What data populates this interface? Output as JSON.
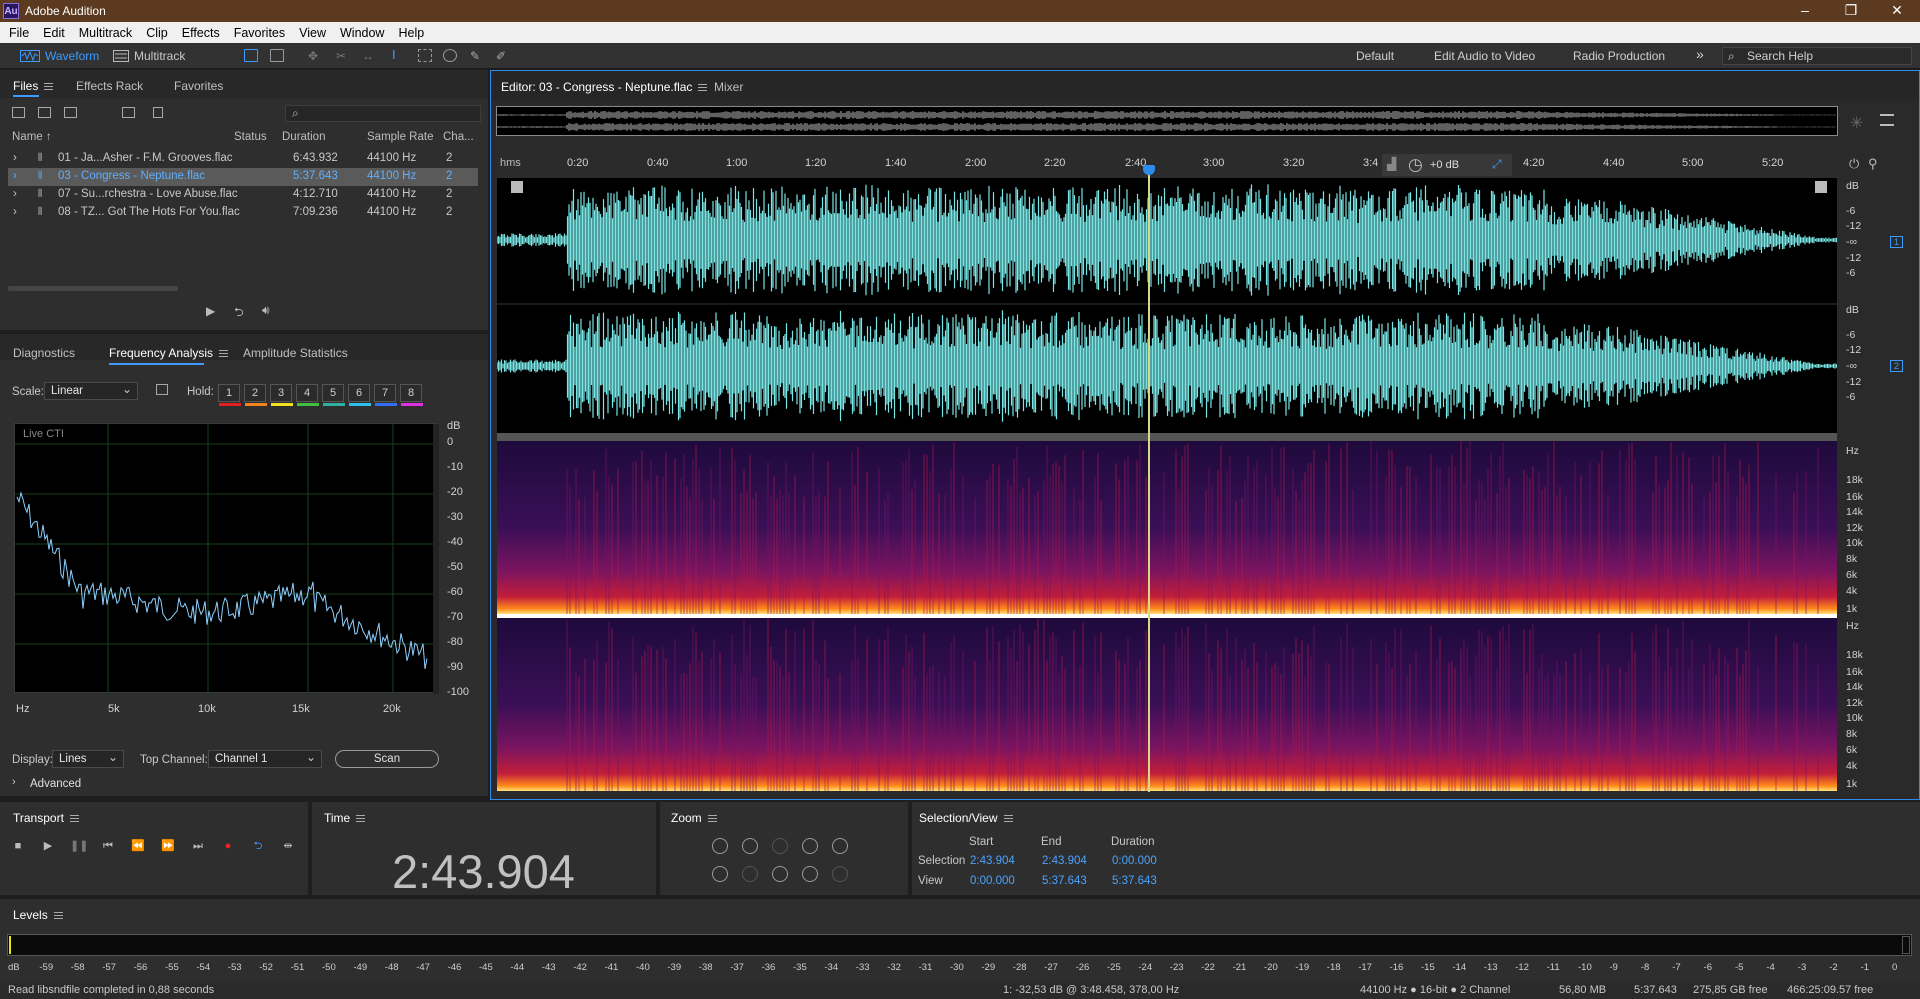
{
  "app": {
    "title": "Adobe Audition",
    "logo": "Au"
  },
  "menu": [
    "File",
    "Edit",
    "Multitrack",
    "Clip",
    "Effects",
    "Favorites",
    "View",
    "Window",
    "Help"
  ],
  "toolbar": {
    "waveform": "Waveform",
    "multitrack": "Multitrack",
    "workspaces": [
      "Default",
      "Edit Audio to Video",
      "Radio Production"
    ],
    "more": "»",
    "search_placeholder": "Search Help"
  },
  "files_panel": {
    "tabs": [
      "Files",
      "Effects Rack",
      "Favorites"
    ],
    "columns": [
      "Name ↑",
      "Status",
      "Duration",
      "Sample Rate",
      "Cha..."
    ],
    "rows": [
      {
        "name": "01 - Ja...Asher - F.M. Grooves.flac",
        "duration": "6:43.932",
        "rate": "44100 Hz",
        "ch": "2"
      },
      {
        "name": "03 - Congress - Neptune.flac",
        "duration": "5:37.643",
        "rate": "44100 Hz",
        "ch": "2"
      },
      {
        "name": "07 - Su...rchestra - Love Abuse.flac",
        "duration": "4:12.710",
        "rate": "44100 Hz",
        "ch": "2"
      },
      {
        "name": "08 - TZ... Got The Hots For You.flac",
        "duration": "7:09.236",
        "rate": "44100 Hz",
        "ch": "2"
      }
    ]
  },
  "analysis_panel": {
    "tabs": [
      "Diagnostics",
      "Frequency Analysis",
      "Amplitude Statistics"
    ],
    "scale_label": "Scale:",
    "scale_value": "Linear",
    "hold_label": "Hold:",
    "hold_buttons": [
      "1",
      "2",
      "3",
      "4",
      "5",
      "6",
      "7",
      "8"
    ],
    "hold_colors": [
      "#e02020",
      "#f08020",
      "#f0e020",
      "#40c040",
      "#30b0a0",
      "#30c0f0",
      "#3070f0",
      "#e030e0"
    ],
    "graph_label": "Live CTI",
    "db_title": "dB",
    "db_ticks": [
      "0",
      "-10",
      "-20",
      "-30",
      "-40",
      "-50",
      "-60",
      "-70",
      "-80",
      "-90",
      "-100"
    ],
    "hz_ticks": [
      "Hz",
      "5k",
      "10k",
      "15k",
      "20k"
    ],
    "display_label": "Display:",
    "display_value": "Lines",
    "top_channel_label": "Top Channel:",
    "top_channel_value": "Channel 1",
    "scan": "Scan",
    "advanced": "Advanced"
  },
  "editor": {
    "tab": "Editor: 03 - Congress - Neptune.flac",
    "mixer": "Mixer",
    "ruler_unit": "hms",
    "ruler_ticks": [
      "0:20",
      "0:40",
      "1:00",
      "1:20",
      "1:40",
      "2:00",
      "2:20",
      "2:40",
      "3:00",
      "3:20",
      "3:4",
      "4:20",
      "4:40",
      "5:00",
      "5:20"
    ],
    "gain": "+0 dB",
    "wave_db_ticks": [
      "dB",
      "-6",
      "-12",
      "-∞",
      "-12",
      "-6"
    ],
    "channel_labels": [
      "1",
      "2"
    ],
    "spec_ticks": [
      "Hz",
      "18k",
      "16k",
      "14k",
      "12k",
      "10k",
      "8k",
      "6k",
      "4k",
      "1k"
    ]
  },
  "transport": {
    "title": "Transport"
  },
  "time": {
    "title": "Time",
    "value": "2:43.904"
  },
  "zoom": {
    "title": "Zoom"
  },
  "selection_view": {
    "title": "Selection/View",
    "headers": [
      "Start",
      "End",
      "Duration"
    ],
    "rows": [
      {
        "label": "Selection",
        "start": "2:43.904",
        "end": "2:43.904",
        "duration": "0:00.000"
      },
      {
        "label": "View",
        "start": "0:00.000",
        "end": "5:37.643",
        "duration": "5:37.643"
      }
    ]
  },
  "levels": {
    "title": "Levels",
    "ticks": [
      "dB",
      "-59",
      "-58",
      "-57",
      "-56",
      "-55",
      "-54",
      "-53",
      "-52",
      "-51",
      "-50",
      "-49",
      "-48",
      "-47",
      "-46",
      "-45",
      "-44",
      "-43",
      "-42",
      "-41",
      "-40",
      "-39",
      "-38",
      "-37",
      "-36",
      "-35",
      "-34",
      "-33",
      "-32",
      "-31",
      "-30",
      "-29",
      "-28",
      "-27",
      "-26",
      "-25",
      "-24",
      "-23",
      "-22",
      "-21",
      "-20",
      "-19",
      "-18",
      "-17",
      "-16",
      "-15",
      "-14",
      "-13",
      "-12",
      "-11",
      "-10",
      "-9",
      "-8",
      "-7",
      "-6",
      "-5",
      "-4",
      "-3",
      "-2",
      "-1",
      "0"
    ]
  },
  "status": {
    "left": "Read libsndfile completed in 0,88 seconds",
    "cursor": "1: -32,53 dB @ 3:48.458, 378,00 Hz",
    "format": "44100 Hz ● 16-bit ● 2 Channel",
    "size": "56,80 MB",
    "duration": "5:37.643",
    "free": "275,85 GB free",
    "time_free": "466:25:09.57 free"
  },
  "colors": {
    "accent": "#2d8ceb",
    "waveform": "#79e6e6",
    "selected_text": "#5fb0ff"
  }
}
